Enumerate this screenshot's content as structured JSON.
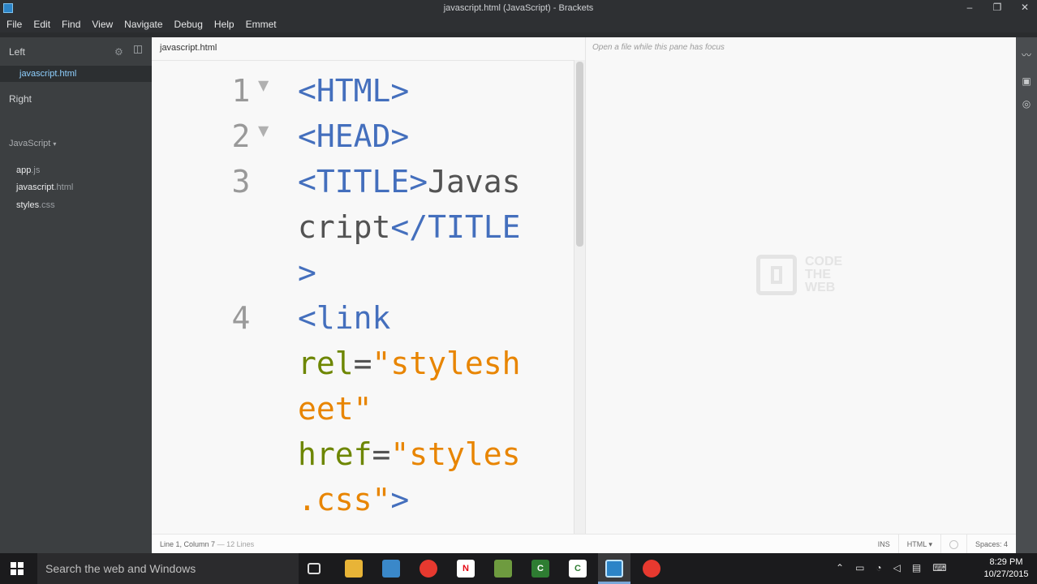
{
  "window": {
    "title": "javascript.html (JavaScript) - Brackets"
  },
  "menu": [
    "File",
    "Edit",
    "Find",
    "View",
    "Navigate",
    "Debug",
    "Help",
    "Emmet"
  ],
  "sidebar": {
    "left_label": "Left",
    "active_file": "javascript.html",
    "right_label": "Right",
    "project": "JavaScript",
    "project_caret": "▾",
    "files": [
      {
        "name": "app",
        "ext": ".js"
      },
      {
        "name": "javascript",
        "ext": ".html"
      },
      {
        "name": "styles",
        "ext": ".css"
      }
    ]
  },
  "editor": {
    "tab": "javascript.html",
    "lines": [
      {
        "num": "1",
        "fold": "▼",
        "parts": [
          {
            "c": "tag",
            "t": "<HTML>"
          }
        ]
      },
      {
        "num": "2",
        "fold": "▼",
        "parts": [
          {
            "c": "tag",
            "t": "<HEAD>"
          }
        ]
      },
      {
        "num": "3",
        "fold": "",
        "parts": [
          {
            "c": "tag",
            "t": "<TITLE>"
          },
          {
            "c": "text",
            "t": "Javas"
          }
        ]
      },
      {
        "num": "",
        "fold": "",
        "parts": [
          {
            "c": "text",
            "t": "cript"
          },
          {
            "c": "tag",
            "t": "</TITLE"
          }
        ]
      },
      {
        "num": "",
        "fold": "",
        "parts": [
          {
            "c": "tag",
            "t": ">"
          }
        ]
      },
      {
        "num": "4",
        "fold": "",
        "parts": [
          {
            "c": "tag",
            "t": "<link"
          }
        ]
      },
      {
        "num": "",
        "fold": "",
        "parts": [
          {
            "c": "attr",
            "t": "rel"
          },
          {
            "c": "text",
            "t": "="
          },
          {
            "c": "val",
            "t": "\"stylesh"
          }
        ]
      },
      {
        "num": "",
        "fold": "",
        "parts": [
          {
            "c": "val",
            "t": "eet\""
          }
        ]
      },
      {
        "num": "",
        "fold": "",
        "parts": [
          {
            "c": "attr",
            "t": "href"
          },
          {
            "c": "text",
            "t": "="
          },
          {
            "c": "val",
            "t": "\"styles"
          }
        ]
      },
      {
        "num": "",
        "fold": "",
        "parts": [
          {
            "c": "val",
            "t": ".css\""
          },
          {
            "c": "tag",
            "t": ">"
          }
        ]
      }
    ]
  },
  "right_pane": {
    "hint": "Open a file while this pane has focus",
    "logo": [
      "CODE",
      "THE",
      "WEB"
    ]
  },
  "status": {
    "position": "Line 1, Column 7",
    "lines": "— 12 Lines",
    "mode": "INS",
    "language": "HTML ▾",
    "spaces": "Spaces: 4"
  },
  "taskbar": {
    "search_placeholder": "Search the web and Windows",
    "time": "8:29 PM",
    "date": "10/27/2015"
  },
  "colors": {
    "tag": "#446fbd",
    "text": "#535353",
    "attr": "#6d8600",
    "value": "#e88501",
    "active_file": "#8fd0ff"
  }
}
